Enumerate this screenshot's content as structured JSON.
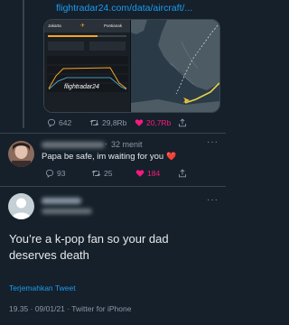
{
  "quoted_tweet": {
    "link_text": "flightradar24.com/data/aircraft/...",
    "flight_panel": {
      "origin": "Jakarta",
      "destination": "Pontianak",
      "logo_text": "flightradar24"
    },
    "stats": {
      "replies": "642",
      "retweets": "29,8Rb",
      "likes": "20,7Rb"
    }
  },
  "reply": {
    "time": "32 menit",
    "text": "Papa be safe, im waiting for you",
    "heart": "❤️",
    "stats": {
      "replies": "93",
      "retweets": "25",
      "likes": "184"
    }
  },
  "main_tweet": {
    "text": "You’re a k-pop fan so your dad deserves death",
    "translate_label": "Terjemahkan Tweet",
    "timestamp": "19.35 · 09/01/21 · Twitter for iPhone"
  },
  "colors": {
    "background": "#15202b",
    "accent": "#1d9bf0",
    "like": "#f91880",
    "muted": "#8b98a5"
  }
}
